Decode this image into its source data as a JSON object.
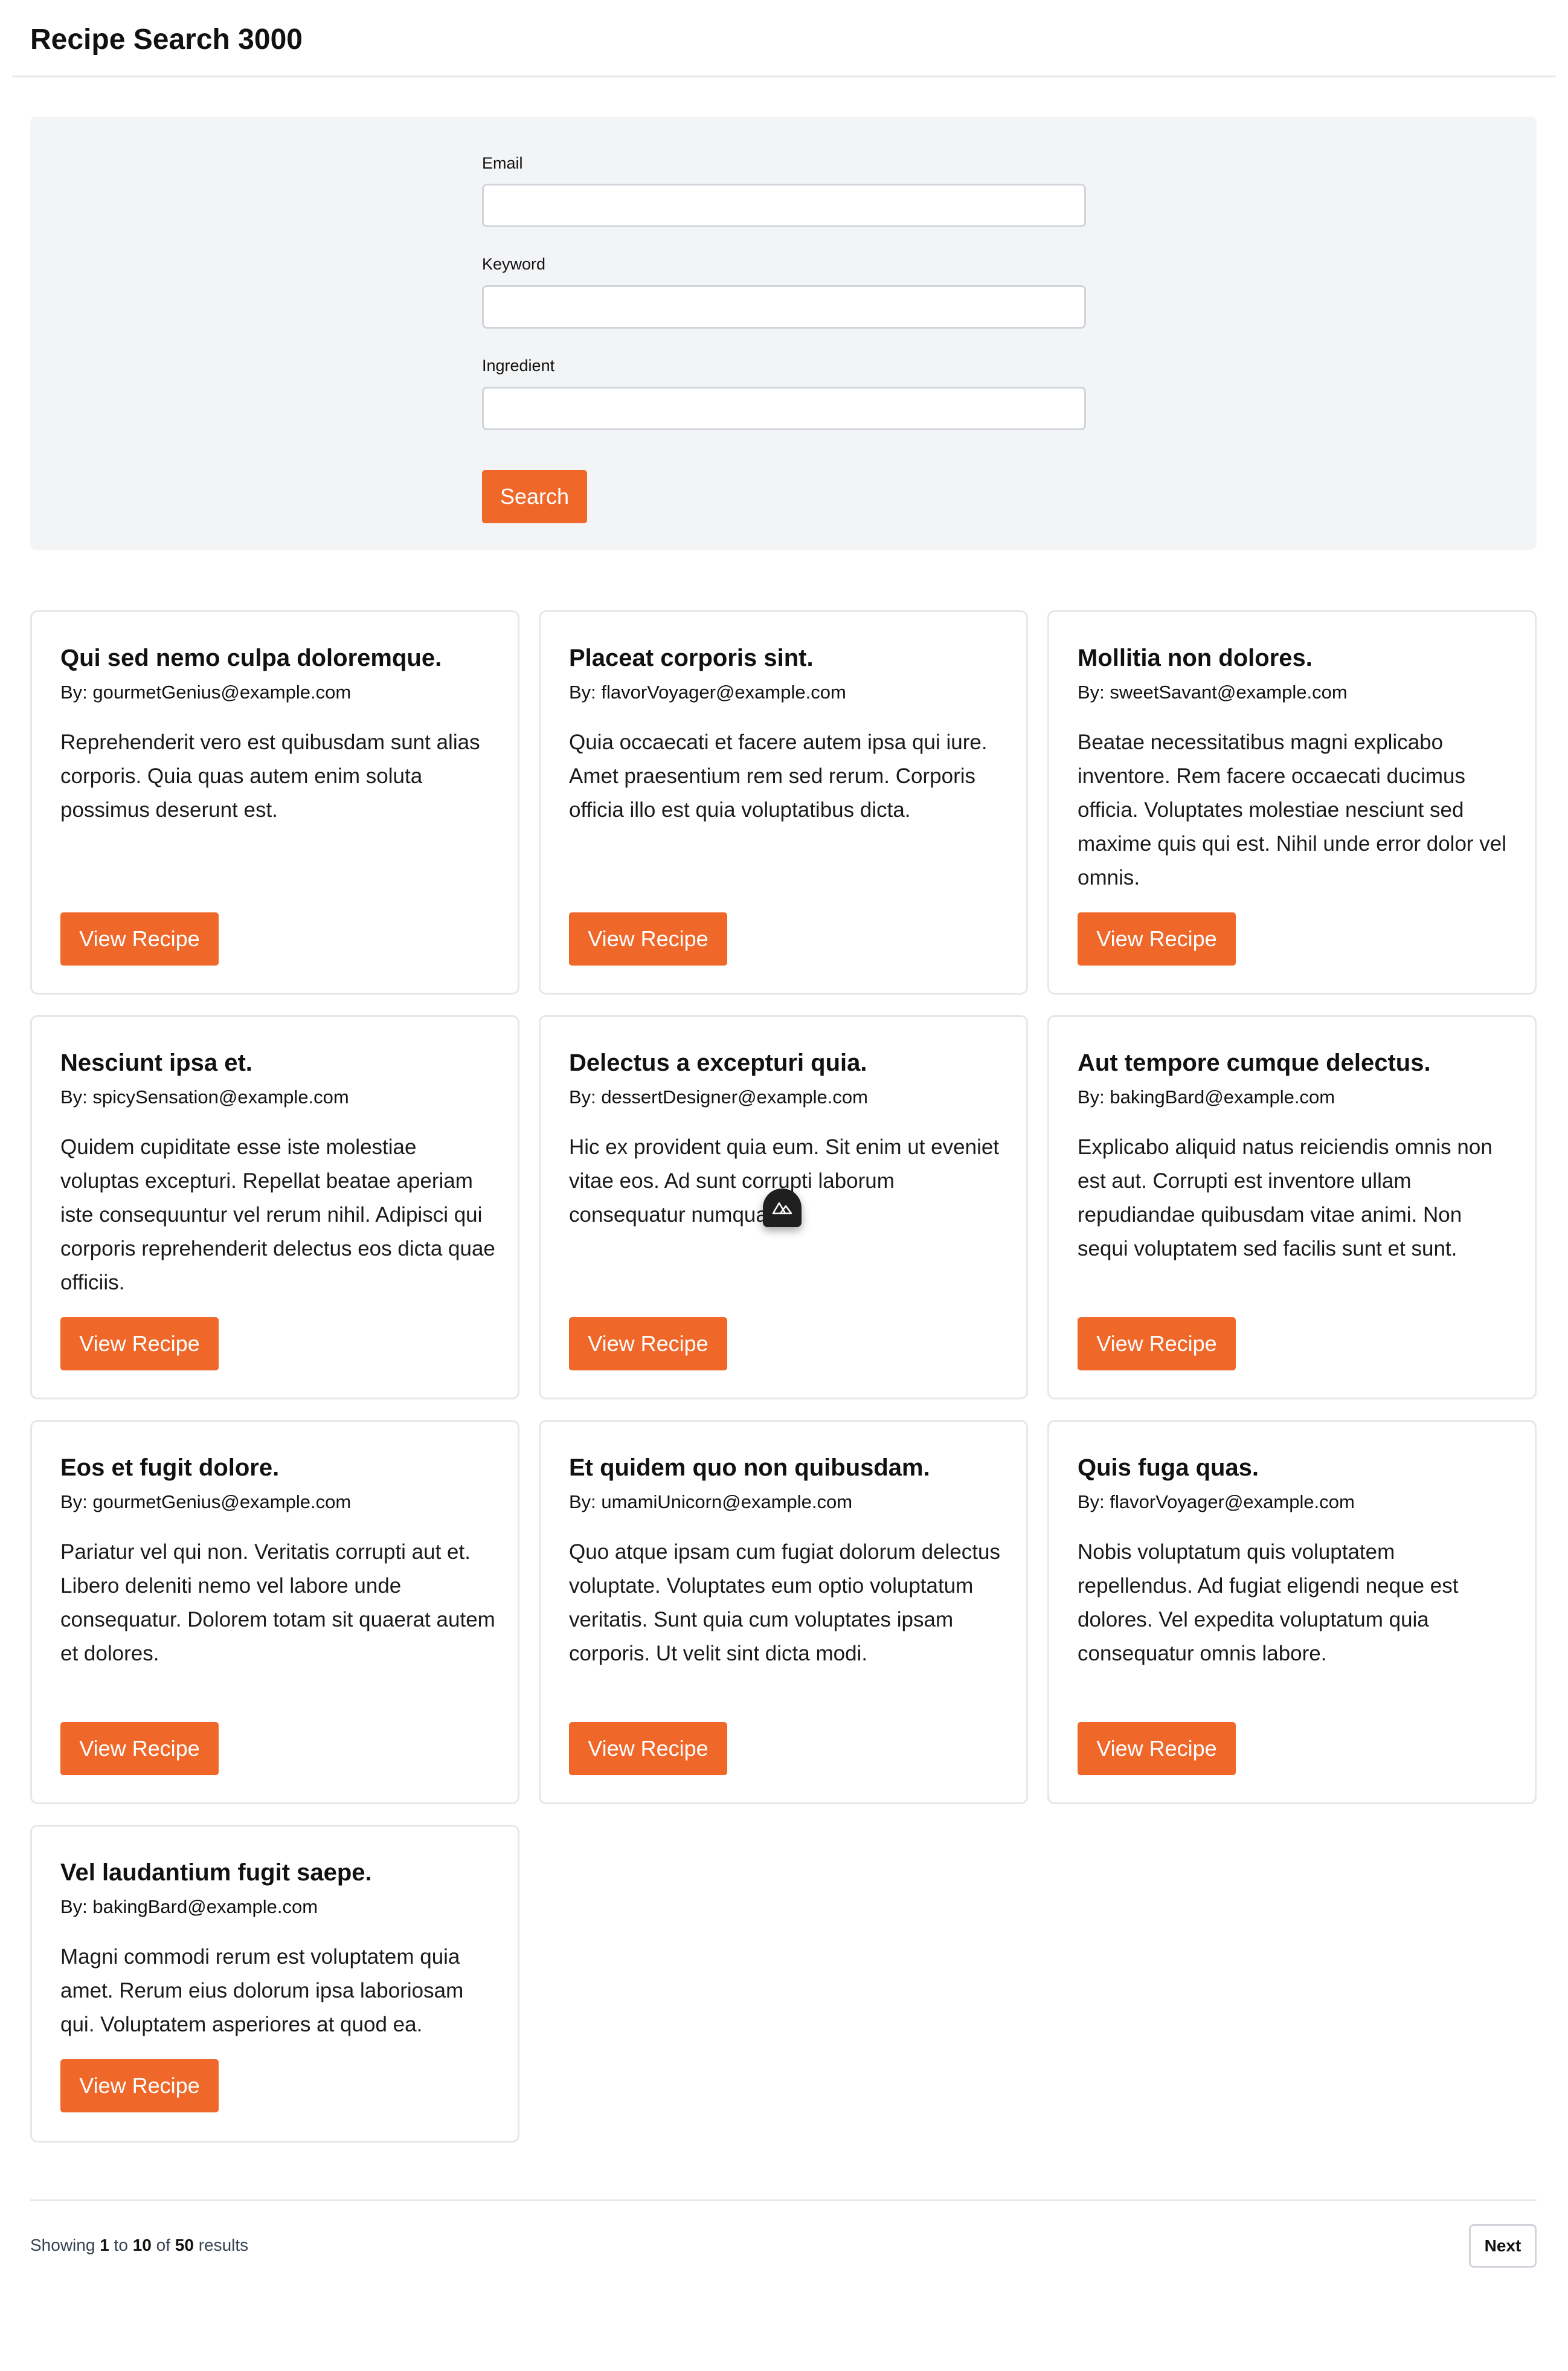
{
  "header": {
    "title": "Recipe Search 3000"
  },
  "search_form": {
    "email_label": "Email",
    "email_value": "",
    "keyword_label": "Keyword",
    "keyword_value": "",
    "ingredient_label": "Ingredient",
    "ingredient_value": "",
    "search_label": "Search"
  },
  "recipes": [
    {
      "title": "Qui sed nemo culpa doloremque.",
      "author": "By: gourmetGenius@example.com",
      "description": "Reprehenderit vero est quibusdam sunt alias corporis. Quia quas autem enim soluta possimus deserunt est.",
      "button_label": "View Recipe"
    },
    {
      "title": "Placeat corporis sint.",
      "author": "By: flavorVoyager@example.com",
      "description": "Quia occaecati et facere autem ipsa qui iure. Amet praesentium rem sed rerum. Corporis officia illo est quia voluptatibus dicta.",
      "button_label": "View Recipe"
    },
    {
      "title": "Mollitia non dolores.",
      "author": "By: sweetSavant@example.com",
      "description": "Beatae necessitatibus magni explicabo inventore. Rem facere occaecati ducimus officia. Voluptates molestiae nesciunt sed maxime quis qui est. Nihil unde error dolor vel omnis.",
      "button_label": "View Recipe"
    },
    {
      "title": "Nesciunt ipsa et.",
      "author": "By: spicySensation@example.com",
      "description": "Quidem cupiditate esse iste molestiae voluptas excepturi. Repellat beatae aperiam iste consequuntur vel rerum nihil. Adipisci qui corporis reprehenderit delectus eos dicta quae officiis.",
      "button_label": "View Recipe"
    },
    {
      "title": "Delectus a excepturi quia.",
      "author": "By: dessertDesigner@example.com",
      "description": "Hic ex provident quia eum. Sit enim ut eveniet vitae eos. Ad sunt corrupti laborum consequatur numquam.",
      "button_label": "View Recipe"
    },
    {
      "title": "Aut tempore cumque delectus.",
      "author": "By: bakingBard@example.com",
      "description": "Explicabo aliquid natus reiciendis omnis non est aut. Corrupti est inventore ullam repudiandae quibusdam vitae animi. Non sequi voluptatem sed facilis sunt et sunt.",
      "button_label": "View Recipe"
    },
    {
      "title": "Eos et fugit dolore.",
      "author": "By: gourmetGenius@example.com",
      "description": "Pariatur vel qui non. Veritatis corrupti aut et. Libero deleniti nemo vel labore unde consequatur. Dolorem totam sit quaerat autem et dolores.",
      "button_label": "View Recipe"
    },
    {
      "title": "Et quidem quo non quibusdam.",
      "author": "By: umamiUnicorn@example.com",
      "description": "Quo atque ipsam cum fugiat dolorum delectus voluptate. Voluptates eum optio voluptatum veritatis. Sunt quia cum voluptates ipsam corporis. Ut velit sint dicta modi.",
      "button_label": "View Recipe"
    },
    {
      "title": "Quis fuga quas.",
      "author": "By: flavorVoyager@example.com",
      "description": "Nobis voluptatum quis voluptatem repellendus. Ad fugiat eligendi neque est dolores. Vel expedita voluptatum quia consequatur omnis labore.",
      "button_label": "View Recipe"
    },
    {
      "title": "Vel laudantium fugit saepe.",
      "author": "By: bakingBard@example.com",
      "description": "Magni commodi rerum est voluptatem quia amet. Rerum eius dolorum ipsa laboriosam qui. Voluptatem asperiores at quod ea.",
      "button_label": "View Recipe"
    }
  ],
  "pagination": {
    "showing_prefix": "Showing",
    "from": "1",
    "to_word": "to",
    "to": "10",
    "of_word": "of",
    "total": "50",
    "results_word": "results",
    "next_label": "Next"
  },
  "overlay_badge": {
    "icon": "mountain-logo-icon"
  },
  "colors": {
    "accent": "#f0672a",
    "panel_background": "#f3f4f6",
    "border": "#e5e7eb"
  }
}
